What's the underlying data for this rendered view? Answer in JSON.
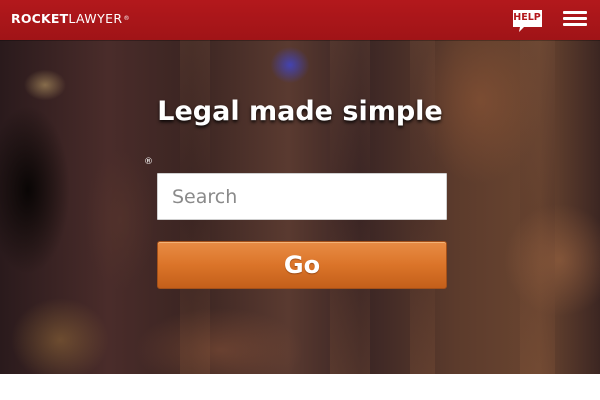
{
  "header": {
    "logo_rocket": "ROCKET",
    "logo_lawyer": "LAWYER",
    "logo_reg": "®",
    "help_label": "HELP",
    "menu_icon": "hamburger-menu-icon",
    "background_color": "#b3181c"
  },
  "hero": {
    "title": "Legal made simple",
    "reg_mark": "®",
    "search": {
      "placeholder": "Search",
      "value": ""
    },
    "go_label": "Go",
    "button_color": "#db7429"
  }
}
